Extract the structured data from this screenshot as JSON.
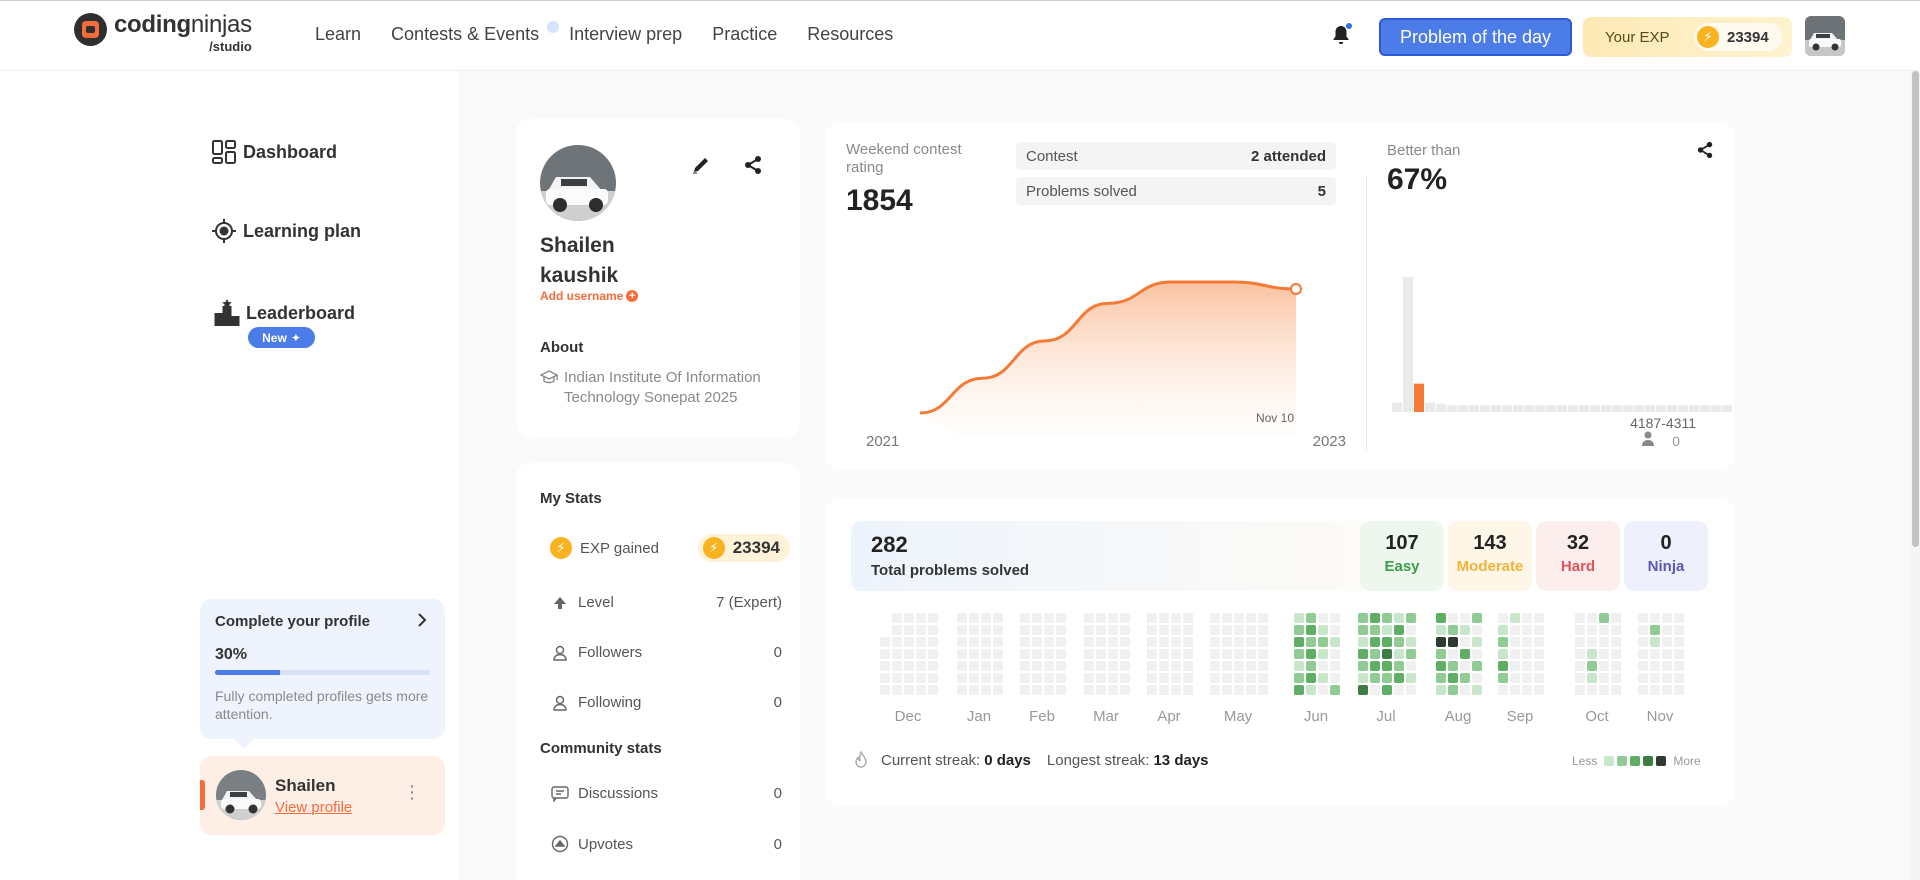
{
  "header": {
    "brand": {
      "name_bold": "coding",
      "name_light": "ninjas",
      "sub": "/studio"
    },
    "nav": [
      "Learn",
      "Contests & Events",
      "Interview prep",
      "Practice",
      "Resources"
    ],
    "potd_label": "Problem of the day",
    "exp_label": "Your EXP",
    "exp_value": "23394"
  },
  "sidebar": {
    "items": [
      {
        "label": "Dashboard",
        "icon": "dashboard-icon"
      },
      {
        "label": "Learning plan",
        "icon": "target-icon"
      },
      {
        "label": "Leaderboard",
        "icon": "podium-icon"
      }
    ],
    "new_badge": "New",
    "complete_profile": {
      "title": "Complete your profile",
      "percent_text": "30%",
      "percent": 0.3,
      "hint": "Fully completed profiles gets more attention."
    },
    "user": {
      "name": "Shailen",
      "link": "View profile"
    }
  },
  "profile": {
    "first_name": "Shailen",
    "last_name": "kaushik",
    "add_username": "Add username",
    "about_heading": "About",
    "institute": "Indian Institute Of Information Technology Sonepat 2025"
  },
  "stats": {
    "heading": "My Stats",
    "exp": {
      "label": "EXP gained",
      "value": "23394"
    },
    "rows": [
      {
        "label": "Level",
        "value": "7 (Expert)",
        "icon": "arrow-up-icon"
      },
      {
        "label": "Followers",
        "value": "0",
        "icon": "person-icon"
      },
      {
        "label": "Following",
        "value": "0",
        "icon": "person-icon"
      }
    ],
    "community_heading": "Community stats",
    "community": [
      {
        "label": "Discussions",
        "value": "0",
        "icon": "chat-icon"
      },
      {
        "label": "Upvotes",
        "value": "0",
        "icon": "upvote-icon"
      }
    ]
  },
  "rating": {
    "label": "Weekend contest rating",
    "value": "1854",
    "table": [
      {
        "label": "Contest",
        "value": "2 attended"
      },
      {
        "label": "Problems solved",
        "value": "5"
      }
    ],
    "better_label": "Better than",
    "better_value": "67%",
    "x_start": "2021",
    "x_end": "2023",
    "last_point_label": "Nov 10",
    "range_label": "4187-4311",
    "users_in_range": "0"
  },
  "problems": {
    "total": "282",
    "total_label": "Total problems solved",
    "difficulty": [
      {
        "count": "107",
        "label": "Easy",
        "bg": "#eef7ee",
        "color": "#3a9c4a"
      },
      {
        "count": "143",
        "label": "Moderate",
        "bg": "#fef7e8",
        "color": "#f2b338"
      },
      {
        "count": "32",
        "label": "Hard",
        "bg": "#fdeeee",
        "color": "#e0555a"
      },
      {
        "count": "0",
        "label": "Ninja",
        "bg": "#eef0fb",
        "color": "#5a57b8"
      }
    ],
    "months": [
      "Dec",
      "Jan",
      "Feb",
      "Mar",
      "Apr",
      "May",
      "Jun",
      "Jul",
      "Aug",
      "Sep",
      "Oct",
      "Nov"
    ],
    "current_streak_label": "Current streak:",
    "current_streak": "0 days",
    "longest_streak_label": "Longest streak:",
    "longest_streak": "13 days",
    "legend_less": "Less",
    "legend_more": "More",
    "heat_colors": [
      "#f0f0f0",
      "#c8e6c9",
      "#8fcb93",
      "#5fae66",
      "#3f7c45",
      "#2f3a30"
    ]
  },
  "chart_data": [
    {
      "type": "area",
      "title": "Weekend contest rating",
      "x": [
        "2021",
        "",
        "",
        "",
        "",
        "",
        "Nov 10"
      ],
      "values": [
        1390,
        1520,
        1660,
        1800,
        1880,
        1880,
        1854
      ],
      "x_ticks": [
        "2021",
        "2023"
      ],
      "color": "#f47a36"
    },
    {
      "type": "bar",
      "title": "Better than",
      "values": [
        7,
        100,
        21,
        7,
        6,
        5,
        5,
        5,
        5,
        5,
        5,
        5,
        5,
        5,
        5,
        5,
        5,
        5,
        5,
        5,
        5,
        5,
        5,
        5,
        5,
        5,
        5,
        5,
        5,
        5,
        5
      ],
      "highlight_index": 2,
      "x_ticks": [
        "4187-4311"
      ],
      "color": "#eaeaea",
      "highlight_color": "#f47a36"
    }
  ]
}
